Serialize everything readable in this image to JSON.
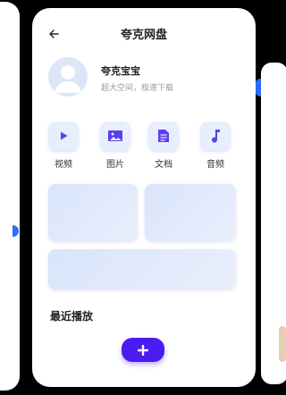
{
  "header": {
    "back_icon": "arrow-left-icon",
    "title": "夸克网盘"
  },
  "profile": {
    "name": "夸克宝宝",
    "subtitle": "超大空间，极速下载",
    "avatar_icon": "user-avatar-icon"
  },
  "tools": [
    {
      "label": "视频",
      "icon": "play-icon"
    },
    {
      "label": "图片",
      "icon": "image-icon"
    },
    {
      "label": "文档",
      "icon": "document-icon"
    },
    {
      "label": "音频",
      "icon": "music-note-icon"
    }
  ],
  "section": {
    "title": "最近播放"
  },
  "fab": {
    "label": "+",
    "icon": "plus-icon"
  },
  "colors": {
    "accent": "#4b1bf0",
    "icon_purple": "#5b3ef0",
    "card": "#dbe5fb",
    "tool_bg": "#e7eefd"
  }
}
